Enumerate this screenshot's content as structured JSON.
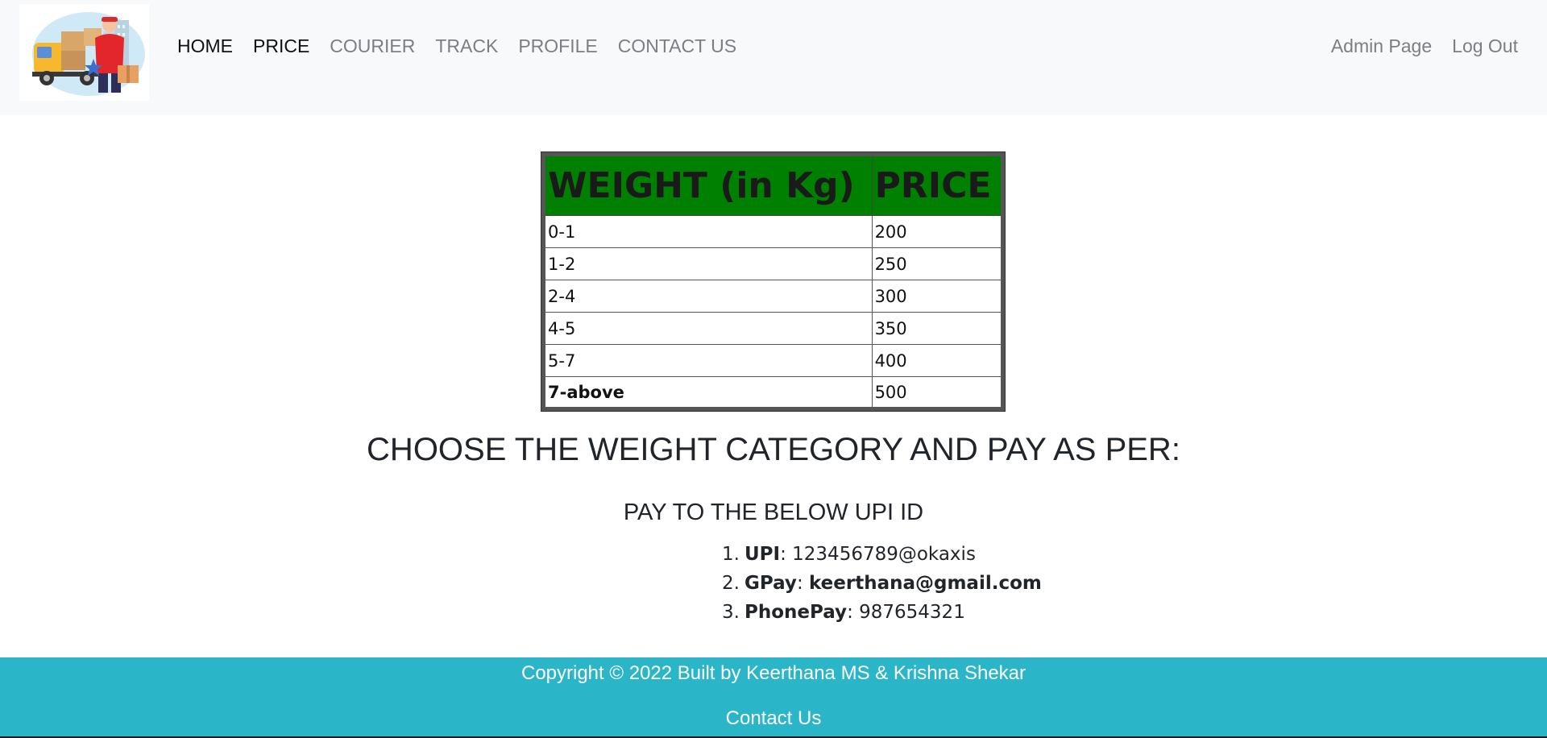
{
  "nav": {
    "left": [
      {
        "label": "HOME",
        "active": true
      },
      {
        "label": "PRICE",
        "active": true
      },
      {
        "label": "COURIER",
        "active": false
      },
      {
        "label": "TRACK",
        "active": false
      },
      {
        "label": "PROFILE",
        "active": false
      },
      {
        "label": "CONTACT US",
        "active": false
      }
    ],
    "right": [
      {
        "label": "Admin Page"
      },
      {
        "label": "Log Out"
      }
    ]
  },
  "price_table": {
    "headers": [
      "WEIGHT (in Kg)",
      "PRICE"
    ],
    "rows": [
      [
        "0-1",
        "200"
      ],
      [
        "1-2",
        "250"
      ],
      [
        "2-4",
        "300"
      ],
      [
        "4-5",
        "350"
      ],
      [
        "5-7",
        "400"
      ],
      [
        "7-above",
        "500"
      ]
    ],
    "header_color": "#008000"
  },
  "main": {
    "choose_heading": "CHOOSE THE WEIGHT CATEGORY AND PAY AS PER:",
    "pay_heading": "PAY TO THE BELOW UPI ID",
    "payments": [
      {
        "num": "1.",
        "key": "UPI",
        "sep": ": ",
        "value": "123456789@okaxis"
      },
      {
        "num": "2.",
        "key": "GPay",
        "sep": ": ",
        "value": "keerthana@gmail.com"
      },
      {
        "num": "3.",
        "key": "PhonePay",
        "sep": ": ",
        "value": "987654321"
      }
    ]
  },
  "footer": {
    "copyright": "Copyright © 2022 Built by Keerthana MS & Krishna Shekar",
    "contact": "Contact Us",
    "background": "#2ab5c9"
  }
}
